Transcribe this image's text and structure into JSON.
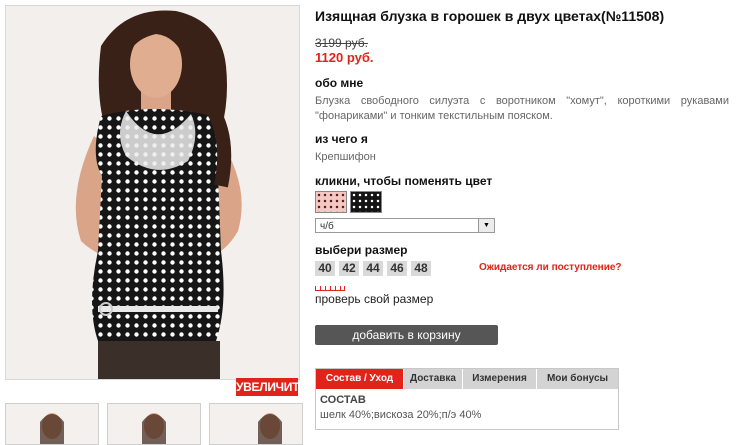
{
  "product": {
    "title": "Изящная блузка в горошек в двух цветах(№11508)",
    "old_price": "3199 руб.",
    "new_price": "1120 руб."
  },
  "about": {
    "label": "обо мне",
    "text": "Блузка свободного силуэта с воротником \"хомут\", короткими рукавами \"фонариками\" и тонким текстильным пояском."
  },
  "material": {
    "label": "из чего я",
    "text": "Крепшифон"
  },
  "color": {
    "label": "кликни, чтобы поменять цвет",
    "selected": "ч/б"
  },
  "sizes": {
    "label": "выбери размер",
    "items": [
      "40",
      "42",
      "44",
      "46",
      "48"
    ],
    "stock_link": "Ожидается ли поступление?",
    "check_size": "проверь свой размер"
  },
  "cart_button": "добавить в корзину",
  "zoom_button": "УВЕЛИЧИТЬ",
  "tabs": {
    "items": [
      "Состав / Уход",
      "Доставка",
      "Измерения",
      "Мои бонусы"
    ],
    "active": "Состав / Уход",
    "content_title": "СОСТАВ",
    "content_text": "шелк 40%;вискоза 20%;п/э 40%"
  },
  "colors": {
    "accent": "#e2231a",
    "button": "#565656",
    "tab_inactive": "#d3d3d3",
    "size_box": "#d9d9d9"
  }
}
